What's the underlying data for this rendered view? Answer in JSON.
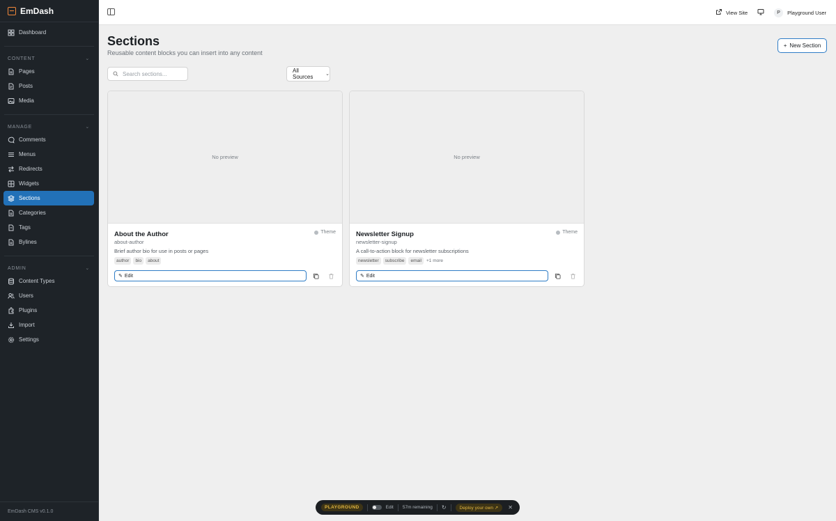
{
  "app": {
    "brand": "EmDash",
    "version": "EmDash CMS v0.1.0"
  },
  "sidebar": {
    "top": [
      {
        "label": "Dashboard",
        "icon": "dashboard-icon"
      }
    ],
    "groups": [
      {
        "title": "CONTENT",
        "items": [
          {
            "label": "Pages",
            "icon": "page-icon"
          },
          {
            "label": "Posts",
            "icon": "post-icon"
          },
          {
            "label": "Media",
            "icon": "image-icon"
          }
        ]
      },
      {
        "title": "MANAGE",
        "items": [
          {
            "label": "Comments",
            "icon": "comment-icon"
          },
          {
            "label": "Menus",
            "icon": "menu-icon"
          },
          {
            "label": "Redirects",
            "icon": "redirect-icon"
          },
          {
            "label": "Widgets",
            "icon": "widget-icon"
          },
          {
            "label": "Sections",
            "icon": "layers-icon",
            "active": true
          },
          {
            "label": "Categories",
            "icon": "category-icon"
          },
          {
            "label": "Tags",
            "icon": "tag-icon"
          },
          {
            "label": "Bylines",
            "icon": "byline-icon"
          }
        ]
      },
      {
        "title": "ADMIN",
        "items": [
          {
            "label": "Content Types",
            "icon": "database-icon"
          },
          {
            "label": "Users",
            "icon": "users-icon"
          },
          {
            "label": "Plugins",
            "icon": "plugin-icon"
          },
          {
            "label": "Import",
            "icon": "import-icon"
          },
          {
            "label": "Settings",
            "icon": "gear-icon"
          }
        ]
      }
    ]
  },
  "topbar": {
    "view_site": "View Site",
    "user_initial": "P",
    "user_name": "Playground User"
  },
  "page": {
    "title": "Sections",
    "subtitle": "Reusable content blocks you can insert into any content",
    "new_button": "New Section",
    "search_placeholder": "Search sections...",
    "source_filter": "All Sources"
  },
  "cards": [
    {
      "preview": "No preview",
      "title": "About the Author",
      "slug": "about-author",
      "description": "Brief author bio for use in posts or pages",
      "source": "Theme",
      "tags": [
        "author",
        "bio",
        "about"
      ],
      "more": "",
      "edit_label": "Edit"
    },
    {
      "preview": "No preview",
      "title": "Newsletter Signup",
      "slug": "newsletter-signup",
      "description": "A call-to-action block for newsletter subscriptions",
      "source": "Theme",
      "tags": [
        "newsletter",
        "subscribe",
        "email"
      ],
      "more": "+1 more",
      "edit_label": "Edit"
    }
  ],
  "playground": {
    "badge": "PLAYGROUND",
    "edit_label": "Edit",
    "remaining": "57m remaining",
    "deploy": "Deploy your own"
  },
  "colors": {
    "accent": "#2271b8",
    "sidebar_bg": "#1e2328",
    "brand": "#f2883a"
  }
}
